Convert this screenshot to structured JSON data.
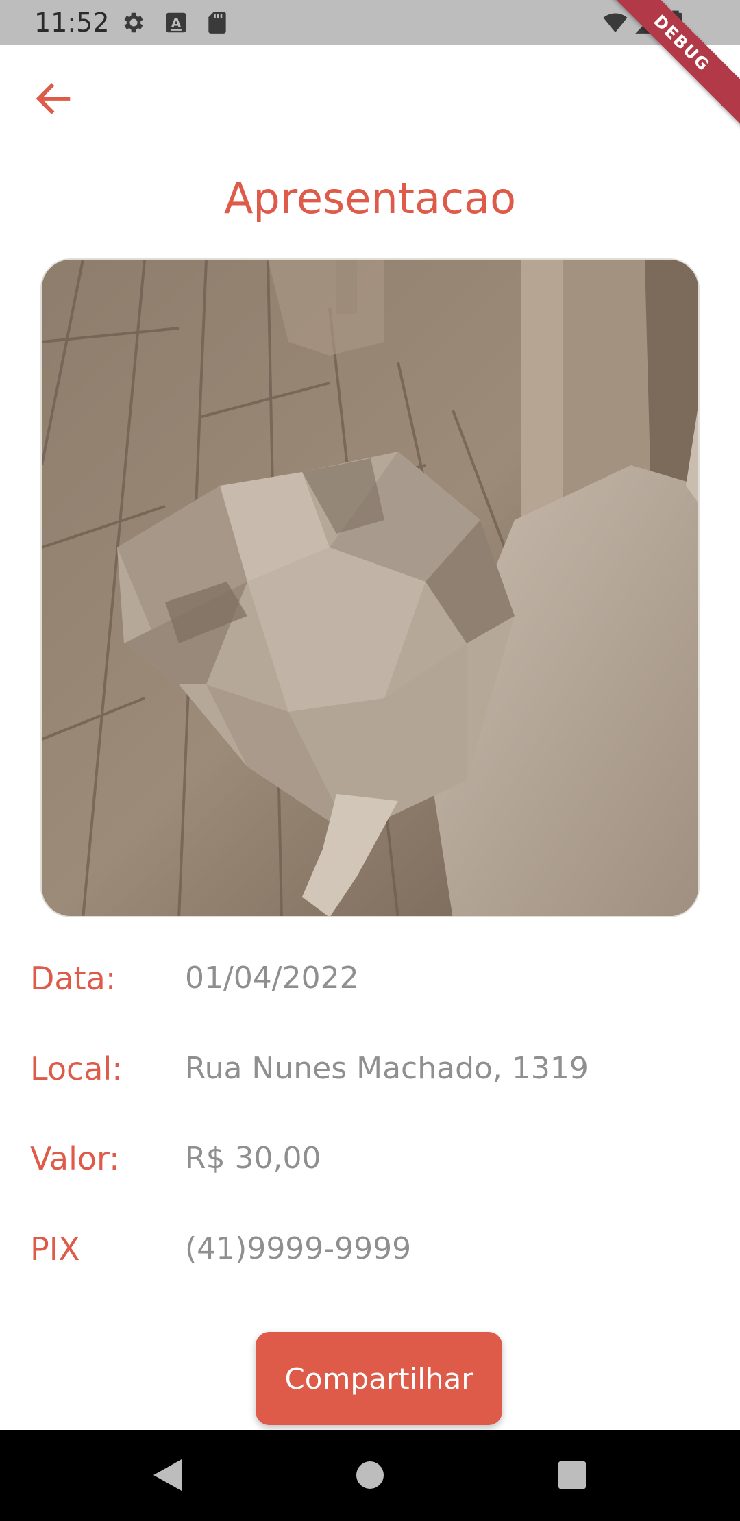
{
  "status_bar": {
    "time": "11:52",
    "left_icons": [
      "gear-icon",
      "a-badge-icon",
      "sd-card-icon"
    ],
    "right_icons": [
      "wifi-icon",
      "signal-icon",
      "battery-icon"
    ],
    "debug_banner": "DEBUG"
  },
  "app_bar": {
    "back_icon": "arrow-left-icon"
  },
  "page": {
    "title": "Apresentacao"
  },
  "details": [
    {
      "label": "Data:",
      "value": "01/04/2022"
    },
    {
      "label": "Local:",
      "value": "Rua Nunes Machado, 1319"
    },
    {
      "label": "Valor:",
      "value": "R$ 30,00"
    },
    {
      "label": "PIX",
      "value": "(41)9999-9999"
    }
  ],
  "share_button": {
    "label": "Compartilhar"
  },
  "nav_bar": {
    "icons": [
      "back-triangle-icon",
      "home-circle-icon",
      "recents-square-icon"
    ]
  },
  "colors": {
    "accent": "#de5b4a",
    "value_text": "#8f8f8f",
    "status_bar": "#bdbdbd",
    "nav_bar": "#000000"
  }
}
